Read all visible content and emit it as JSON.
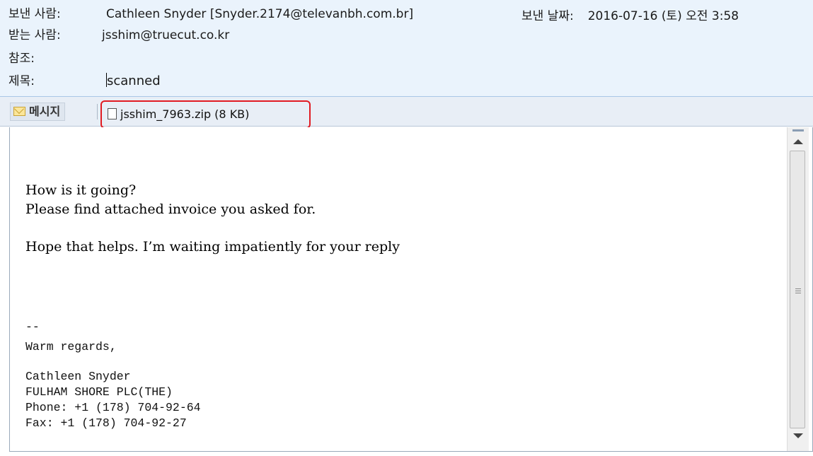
{
  "header": {
    "from_label": "보낸 사람:",
    "from_value": "Cathleen Snyder [Snyder.2174@televanbh.com.br]",
    "date_label": "보낸 날짜:",
    "date_value": "2016-07-16 (토) 오전 3:58",
    "to_label": "받는 사람:",
    "to_value": "jsshim@truecut.co.kr",
    "cc_label": "참조:",
    "cc_value": "",
    "subject_label": "제목:",
    "subject_value": "scanned"
  },
  "tabs": {
    "message_label": "메시지",
    "attachment_label": "jsshim_7963.zip (8 KB)"
  },
  "message": {
    "greeting": "How is it going?",
    "line1": "Please find attached invoice you asked for.",
    "line2": "Hope that helps. I’m waiting impatiently for your reply",
    "sig_sep": "--",
    "sig_regards": "Warm regards,",
    "sig_name": "Cathleen Snyder",
    "sig_company": "FULHAM SHORE PLC(THE)",
    "sig_phone": "Phone: +1 (178) 704-92-64",
    "sig_fax": "Fax: +1 (178) 704-92-27"
  },
  "colors": {
    "header_bg": "#eaf3fc",
    "highlight_box": "#e11b22"
  },
  "icons": [
    "mail-icon",
    "file-icon",
    "scroll-up-icon",
    "scroll-down-icon"
  ]
}
